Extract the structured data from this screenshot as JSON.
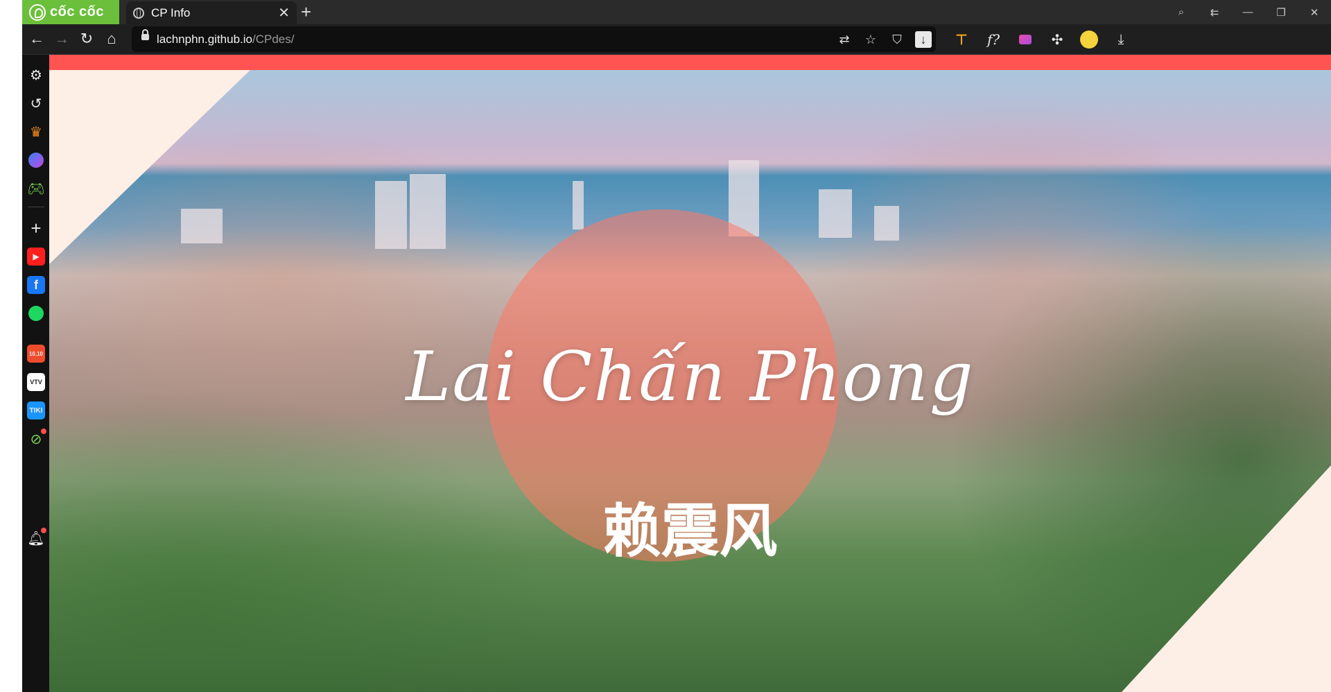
{
  "browser": {
    "brand_text": "cốc cốc",
    "tab": {
      "title": "CP Info"
    },
    "address": {
      "host": "lachnphn.github.io",
      "path": "/CPdes/"
    },
    "toolbar_icons": [
      "translate-icon",
      "star-icon",
      "shield-icon",
      "download-icon"
    ],
    "extension_icons": [
      "extension-orange-icon",
      "formula-icon",
      "pen-icon",
      "puzzle-icon",
      "profile-icon",
      "downloads-icon"
    ]
  },
  "sidebar": {
    "items": [
      "settings-icon",
      "history-icon",
      "crown-icon",
      "messenger-icon",
      "game-icon",
      "add-icon",
      "youtube-icon",
      "facebook-icon",
      "spotify-icon",
      "shopee-icon",
      "vtv-icon",
      "tiki-icon",
      "coccoc-map-icon",
      "notification-icon"
    ],
    "shopee_badge": "10.10",
    "vtv_label": "VTV"
  },
  "page": {
    "name_script": "Lai Chấn Phong",
    "name_chinese": "赖震风"
  },
  "colors": {
    "accent_strip": "#ff5452",
    "page_background": "#fdeee6",
    "circle_overlay": "#ff7864"
  }
}
